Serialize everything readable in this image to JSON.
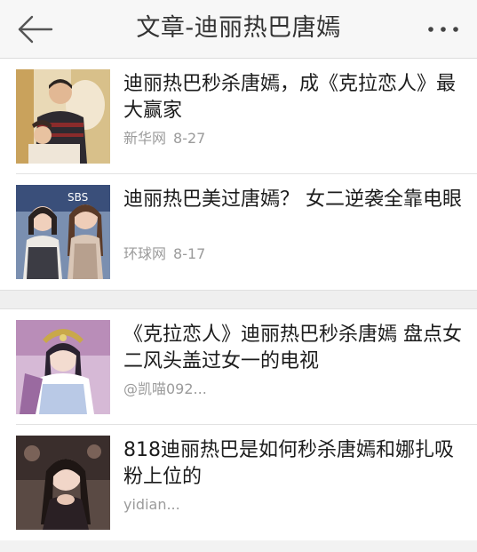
{
  "header": {
    "title": "文章-迪丽热巴唐嫣",
    "back_icon": "back-arrow-icon",
    "more_icon": "more-dots-icon"
  },
  "articles_group_1": [
    {
      "headline": "迪丽热巴秒杀唐嫣，成《克拉恋人》最大赢家",
      "source": "新华网",
      "date": "8-27"
    },
    {
      "headline": "迪丽热巴美过唐嫣？ 女二逆袭全靠电眼",
      "source": "环球网",
      "date": "8-17"
    }
  ],
  "articles_group_2": [
    {
      "headline": "《克拉恋人》迪丽热巴秒杀唐嫣 盘点女二风头盖过女一的电视",
      "source": "@凯喵092..."
    },
    {
      "headline": "818迪丽热巴是如何秒杀唐嫣和娜扎吸粉上位的",
      "source": "yidian..."
    }
  ],
  "colors": {
    "header_bg": "#f7f7f7",
    "meta_text": "#9b9b9b",
    "divider": "#e2e2e2"
  }
}
